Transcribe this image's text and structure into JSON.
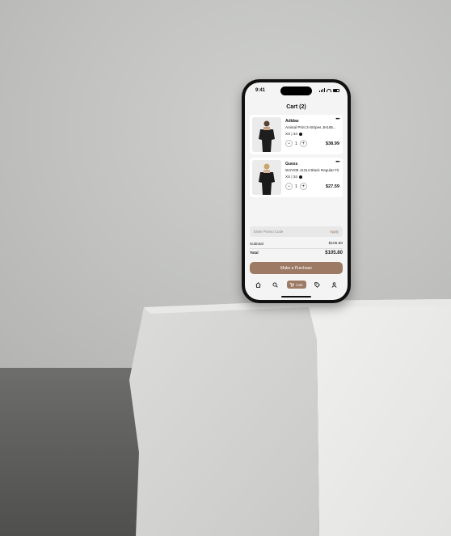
{
  "status": {
    "time": "9:41"
  },
  "cart": {
    "title": "Cart (2)",
    "items": [
      {
        "brand": "Adidas",
        "name": "Animal Print 3-Stripes JH185...",
        "size": "XS | 34",
        "color": "#111111",
        "qty": "1",
        "price": "$38.99"
      },
      {
        "brand": "Guess",
        "name": "W4YI09 J1314 Black Regular Fit",
        "size": "XS | 34",
        "color": "#111111",
        "qty": "1",
        "price": "$27.59"
      }
    ],
    "promo": {
      "placeholder": "Enter Promo Code",
      "apply": "Apply"
    },
    "subtotal": {
      "label": "Subtotal",
      "value": "$105.80"
    },
    "total": {
      "label": "Total",
      "value": "$105.80"
    },
    "purchase_label": "Make a Purchase"
  },
  "tabbar": {
    "items": [
      {
        "icon": "home-icon"
      },
      {
        "icon": "search-icon"
      },
      {
        "icon": "cart-icon",
        "label": "Cart"
      },
      {
        "icon": "tag-icon"
      },
      {
        "icon": "profile-icon"
      }
    ]
  },
  "colors": {
    "accent": "#9d7a63",
    "background": "#f4f4f4"
  }
}
